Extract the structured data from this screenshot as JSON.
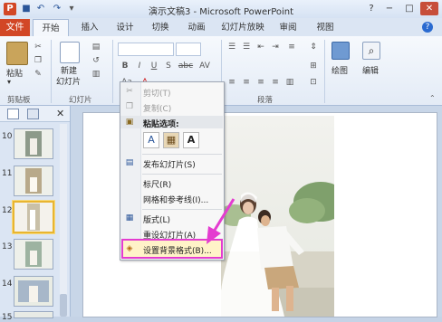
{
  "title_bar": {
    "title": "演示文稿3 - Microsoft PowerPoint",
    "app_icon": "P",
    "controls": [
      "?",
      "−",
      "□",
      "✕"
    ]
  },
  "tabs": [
    "文件",
    "开始",
    "插入",
    "设计",
    "切换",
    "动画",
    "幻灯片放映",
    "审阅",
    "视图"
  ],
  "ribbon": {
    "clipboard": {
      "paste": "粘贴",
      "group": "剪贴板"
    },
    "slides": {
      "new_slide_line1": "新建",
      "new_slide_line2": "幻灯片",
      "group": "幻灯片"
    },
    "font_group_buttons": [
      "B",
      "I",
      "U",
      "S",
      "abc",
      "AV",
      "Aa",
      "A"
    ],
    "paragraph": {
      "group": "段落"
    },
    "drawing": {
      "label": "绘图"
    },
    "editing": {
      "label": "编辑"
    }
  },
  "slides_pane": {
    "numbers": [
      "10",
      "11",
      "12",
      "13",
      "14",
      "15"
    ],
    "selected": "12"
  },
  "context_menu": {
    "cut": "剪切(T)",
    "copy": "复制(C)",
    "paste_options": "粘贴选项:",
    "publish": "发布幻灯片(S)",
    "ruler": "标尺(R)",
    "grid": "网格和参考线(I)...",
    "layout": "版式(L)",
    "reset": "重设幻灯片(A)",
    "format_background": "设置背景格式(B)..."
  },
  "colors": {
    "file_tab": "#d24726",
    "highlight_border": "#e43cd0",
    "arrow": "#e43cd0",
    "selected_thumb": "#e8b530"
  },
  "icons": [
    "scissors-icon",
    "copy-icon",
    "clipboard-icon",
    "paste-keep-icon",
    "paste-picture-icon",
    "paste-text-icon",
    "publish-icon",
    "layout-icon",
    "format-background-icon",
    "arrow-icon"
  ]
}
